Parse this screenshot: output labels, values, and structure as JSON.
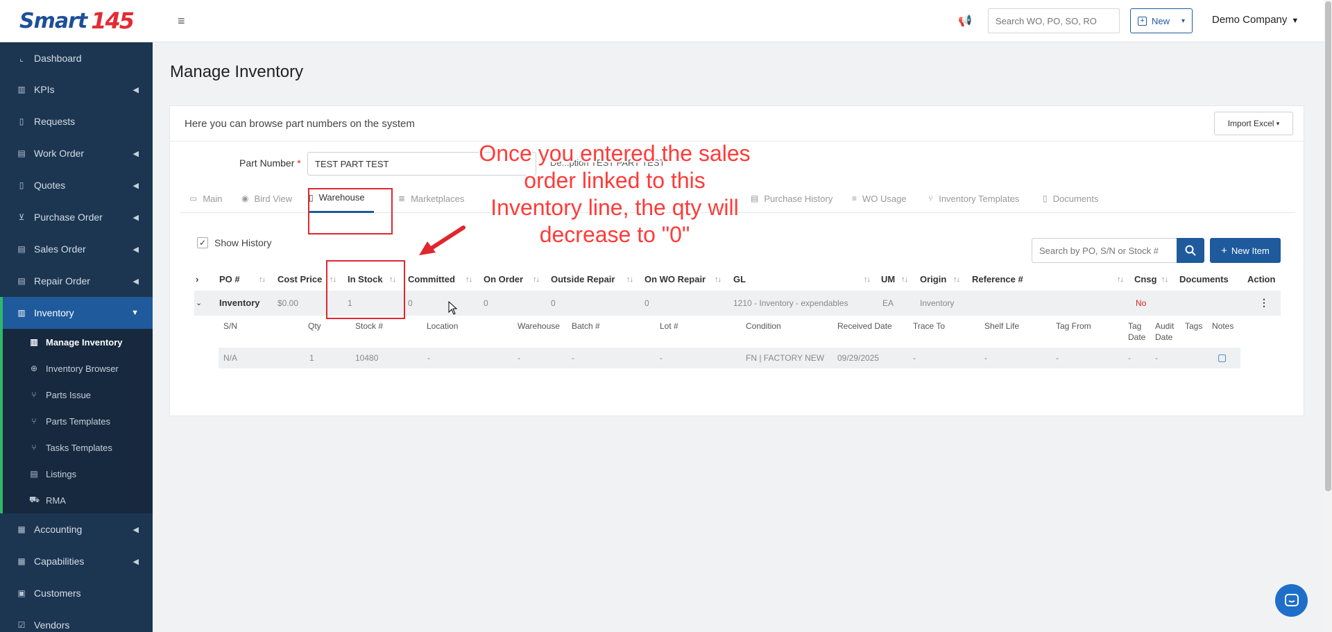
{
  "brand": {
    "name_part1": "Smart",
    "name_part2": "145"
  },
  "sidebar": {
    "items": [
      {
        "label": "Dashboard",
        "icon": "chart-icon",
        "chevron": false
      },
      {
        "label": "KPIs",
        "icon": "bar-chart-icon",
        "chevron": true
      },
      {
        "label": "Requests",
        "icon": "document-icon",
        "chevron": false
      },
      {
        "label": "Work Order",
        "icon": "list-icon",
        "chevron": true
      },
      {
        "label": "Quotes",
        "icon": "clipboard-icon",
        "chevron": true
      },
      {
        "label": "Purchase Order",
        "icon": "cart-icon",
        "chevron": true
      },
      {
        "label": "Sales Order",
        "icon": "list-icon",
        "chevron": true
      },
      {
        "label": "Repair Order",
        "icon": "wrench-icon",
        "chevron": true
      },
      {
        "label": "Inventory",
        "icon": "warehouse-icon",
        "chevron": true
      }
    ],
    "subitems": [
      {
        "label": "Manage Inventory",
        "icon": "warehouse-icon"
      },
      {
        "label": "Inventory Browser",
        "icon": "globe-icon"
      },
      {
        "label": "Parts Issue",
        "icon": "branch-icon"
      },
      {
        "label": "Parts Templates",
        "icon": "branch-icon"
      },
      {
        "label": "Tasks Templates",
        "icon": "branch-icon"
      },
      {
        "label": "Listings",
        "icon": "list-icon"
      },
      {
        "label": "RMA",
        "icon": "truck-icon"
      }
    ],
    "bottom_items": [
      {
        "label": "Accounting",
        "icon": "calculator-icon",
        "chevron": true
      },
      {
        "label": "Capabilities",
        "icon": "grid-icon",
        "chevron": true
      },
      {
        "label": "Customers",
        "icon": "user-icon",
        "chevron": false
      },
      {
        "label": "Vendors",
        "icon": "check-icon",
        "chevron": false
      }
    ]
  },
  "topbar": {
    "search_placeholder": "Search WO, PO, SO, RO",
    "new_label": "New",
    "company": "Demo Company"
  },
  "page": {
    "title": "Manage Inventory",
    "subtitle": "Here you can browse part numbers on the system",
    "import_label": "Import Excel",
    "part_number_label": "Part Number",
    "part_number_required": "*",
    "part_number_value": "TEST PART TEST",
    "description_partial": "De...ption TEST PART TEST"
  },
  "tabs": [
    {
      "label": "Main",
      "icon": "folder-icon"
    },
    {
      "label": "Bird View",
      "icon": "eye-icon"
    },
    {
      "label": "Warehouse",
      "icon": "warehouse-icon",
      "active": true
    },
    {
      "label": "Marketplaces",
      "icon": "list-icon"
    },
    {
      "label": "Purchase History",
      "icon": "cart-icon"
    },
    {
      "label": "WO Usage",
      "icon": "list-icon"
    },
    {
      "label": "Inventory Templates",
      "icon": "branch-icon"
    },
    {
      "label": "Documents",
      "icon": "document-icon"
    }
  ],
  "toolbar": {
    "show_history": "Show History",
    "show_history_checked": true,
    "search_placeholder": "Search by PO, S/N or Stock #",
    "new_item": "New Item"
  },
  "table": {
    "columns": [
      "PO #",
      "Cost Price",
      "In Stock",
      "Committed",
      "On Order",
      "Outside Repair",
      "On WO Repair",
      "GL",
      "UM",
      "Origin",
      "Reference #",
      "Cnsg",
      "Documents",
      "Action"
    ],
    "row": {
      "po": "Inventory",
      "cost_price": "$0.00",
      "in_stock": "1",
      "committed": "0",
      "on_order": "0",
      "outside_repair": "0",
      "on_wo_repair": "0",
      "gl": "1210 - Inventory - expendables",
      "um": "EA",
      "origin": "Inventory",
      "reference": "",
      "cnsg": "No"
    },
    "sub_columns": [
      "S/N",
      "Qty",
      "Stock #",
      "Location",
      "Warehouse",
      "Batch #",
      "Lot #",
      "Condition",
      "Received Date",
      "Trace To",
      "Shelf Life",
      "Tag From",
      "Tag Date",
      "Audit Date",
      "Tags",
      "Notes"
    ],
    "sub_row": {
      "sn": "N/A",
      "qty": "1",
      "stock": "10480",
      "location": "-",
      "warehouse": "-",
      "batch": "-",
      "lot": "-",
      "condition": "FN | FACTORY NEW",
      "received_date": "09/29/2025",
      "trace_to": "-",
      "shelf_life": "-",
      "tag_from": "-",
      "tag_date": "-",
      "audit_date": "-"
    }
  },
  "annotation": {
    "text": "Once you entered the sales order linked to this Inventory line, the qty will decrease to \"0\"",
    "color": "#ff3b38"
  },
  "colors": {
    "sidebar": "#1c3651",
    "accent": "#1e5a9c",
    "active_border": "#2fb86b",
    "no_red": "#e02020"
  }
}
